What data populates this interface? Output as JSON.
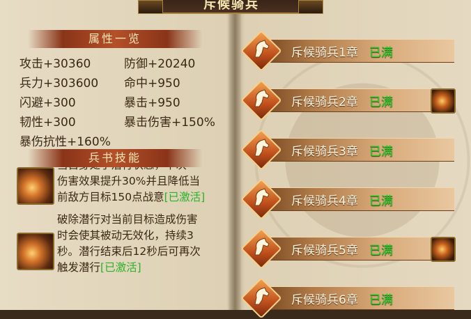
{
  "title": "斥候骑兵",
  "attributes": {
    "header": "属性一览",
    "stats": [
      {
        "label": "攻击+30360"
      },
      {
        "label": "防御+20240"
      },
      {
        "label": "兵力+303600"
      },
      {
        "label": "命中+950"
      },
      {
        "label": "闪避+300"
      },
      {
        "label": "暴击+950"
      },
      {
        "label": "韧性+300"
      },
      {
        "label": "暴击伤害+150%"
      },
      {
        "label": "暴伤抗性+160%"
      }
    ]
  },
  "skills": {
    "header": "兵书技能",
    "items": [
      {
        "lines": [
          "当自身处于潜行状态，下次",
          "伤害效果提升30%并且降低当",
          "前敌方目标150点战意"
        ],
        "status": "[已激活]",
        "icon": "slash-skill-icon"
      },
      {
        "lines": [
          "破除潜行对当前目标造成伤害",
          "时会使其被动无效化，持续3",
          "秒。潜行结束后12秒后可再次",
          "触发潜行"
        ],
        "status": "[已激活]",
        "icon": "warrior-skill-icon"
      }
    ]
  },
  "chapters": [
    {
      "name": "斥候骑兵1章",
      "status": "已满",
      "reward": false
    },
    {
      "name": "斥候骑兵2章",
      "status": "已满",
      "reward": true,
      "reward_icon": "warrior-reward-icon"
    },
    {
      "name": "斥候骑兵3章",
      "status": "已满",
      "reward": false
    },
    {
      "name": "斥候骑兵4章",
      "status": "已满",
      "reward": false
    },
    {
      "name": "斥候骑兵5章",
      "status": "已满",
      "reward": true,
      "reward_icon": "slash-reward-icon"
    },
    {
      "name": "斥候骑兵6章",
      "status": "已满",
      "reward": false
    }
  ],
  "colors": {
    "activated": "#29b22a",
    "full": "#23d023",
    "header": "#b4502a"
  }
}
